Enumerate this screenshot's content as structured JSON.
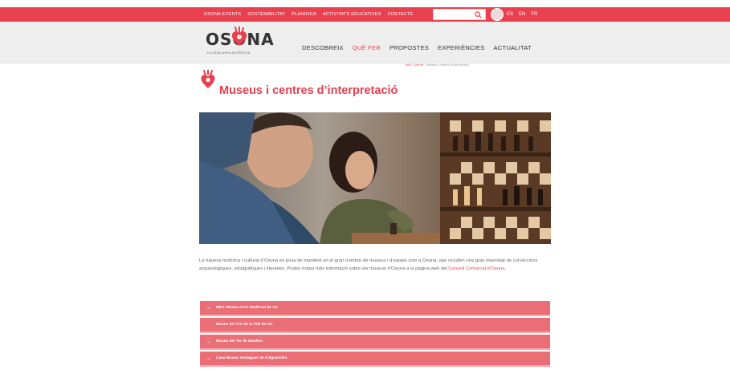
{
  "topbar": {
    "nav": [
      "OSONA EVENTS",
      "SOSTENIBILITAT",
      "PLANIFICA",
      "ACTIVITATS EDUCATIVES",
      "CONTACTE"
    ],
    "languages": [
      "ES",
      "EN",
      "FR"
    ]
  },
  "header": {
    "logo_text": "OSONA",
    "logo_tagline": "LA CATALUNYA AUTÈNTICA",
    "nav": [
      {
        "label": "DESCOBREIX",
        "active": false
      },
      {
        "label": "QUÈ FER",
        "active": true
      },
      {
        "label": "PROPOSTES",
        "active": false
      },
      {
        "label": "EXPERIÈNCIES",
        "active": false
      },
      {
        "label": "ACTUALITAT",
        "active": false
      }
    ]
  },
  "breadcrumb": {
    "items": [
      "Inici",
      "Què fer",
      "Museus i centres d'interpretació"
    ]
  },
  "page": {
    "title": "Museus i centres d’interpretació",
    "intro_1": "La riquesa històrica i cultural d’Osona es posa de manifest en el gran nombre de museus i d’espais com a Osona, que recullen una gran diversitat de col·leccions arqueològiques, etnogràfiques i literàries. Podeu trobar més informació sobre els museus d’Osona a la pàgina web del ",
    "intro_link": "Consell Comarcal d’Osona",
    "intro_2": "."
  },
  "accordion": [
    {
      "label": "MEV. Museu d’Art Medieval de Vic",
      "chevron": "⌄"
    },
    {
      "label": "Museu de l’Art de la Pell de Vic",
      "chevron": ""
    },
    {
      "label": "Museu del Ter de Manlleu",
      "chevron": "⌄"
    },
    {
      "label": "Casa Museu Verdaguer de Folgueroles",
      "chevron": "⌄"
    }
  ],
  "colors": {
    "brand_red": "#e8404f",
    "accordion_bg": "#ea6e76",
    "header_bg": "#eeeeee"
  }
}
